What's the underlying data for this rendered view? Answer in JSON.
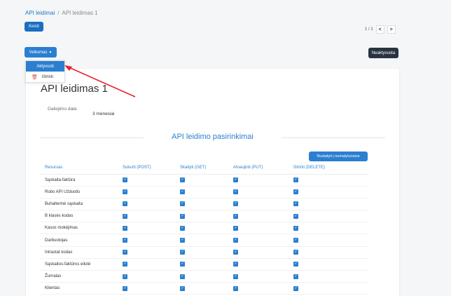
{
  "breadcrumb": {
    "parent": "API leidimai",
    "separator": "/",
    "current": "API leidimas 1"
  },
  "toolbar": {
    "edit_label": "Keisti",
    "actions_label": "Veiksmas",
    "inactive_label": "Neaktyvuota"
  },
  "pager": {
    "text": "1 / 1",
    "prev": "<",
    "next": ">"
  },
  "dropdown": {
    "activate_label": "Aktyvuoti",
    "delete_label": "Ištrinti"
  },
  "card": {
    "title": "API leidimas 1",
    "validity_label": "Galiojimo data",
    "validity_value": "3 mėnesiai",
    "section_title": "API leidimo pasirinkimai",
    "reset_label": "Nustatyti į numatytuosius"
  },
  "table": {
    "headers": [
      "Resursas",
      "Sukurti (POST)",
      "Skaityti (GET)",
      "Atnaujinti (PUT)",
      "Ištrinti (DELETE)"
    ],
    "rows": [
      {
        "name": "Sąskaita-faktūra"
      },
      {
        "name": "Robo API Užduotis"
      },
      {
        "name": "Buhalterinė sąskaita"
      },
      {
        "name": "B klasės kodas"
      },
      {
        "name": "Kasos mokėjimas"
      },
      {
        "name": "Darbuotojas"
      },
      {
        "name": "Intrastat kodas"
      },
      {
        "name": "Sąskaitos-faktūros eilutė"
      },
      {
        "name": "Žurnalas"
      },
      {
        "name": "Klientas"
      }
    ]
  },
  "icons": {
    "checkbox": "checkbox-checked-icon",
    "trash": "trash-icon",
    "annotation": "red-arrow-icon"
  },
  "colors": {
    "primary": "#2b7fd0",
    "dark_button": "#2a3440",
    "danger": "#d9534f",
    "annotation": "#e8222c"
  }
}
